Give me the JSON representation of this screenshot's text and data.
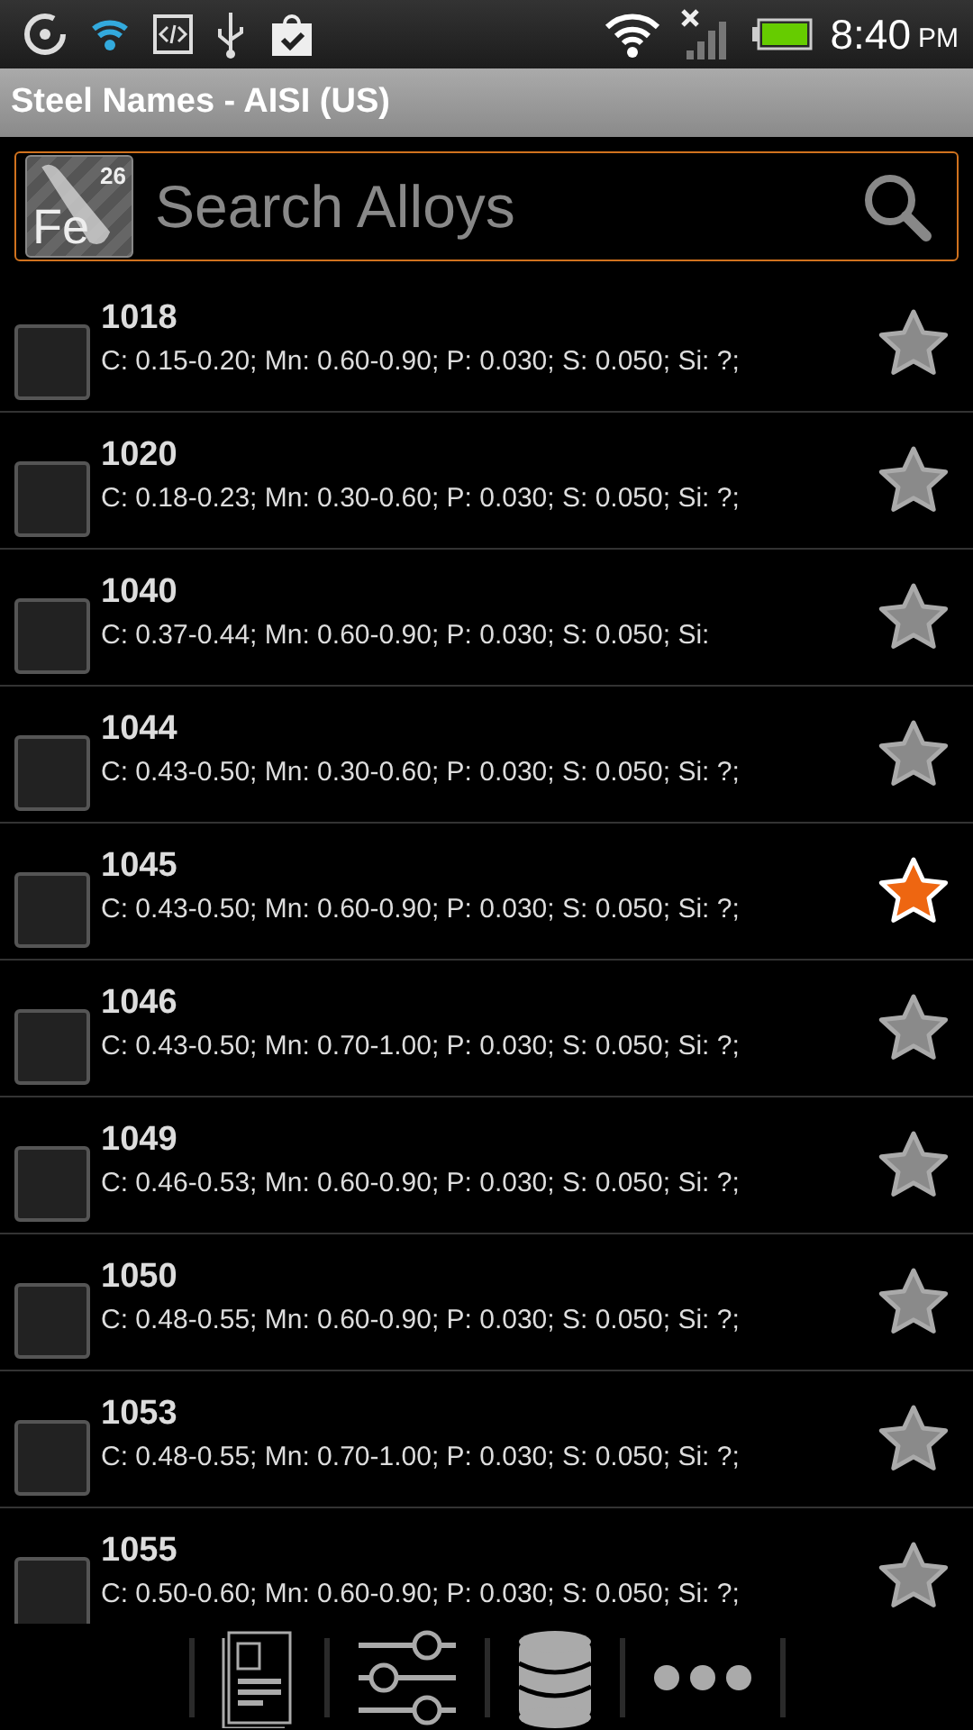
{
  "status_bar": {
    "time": "8:40",
    "ampm": "PM"
  },
  "title": "Steel Names - AISI (US)",
  "search": {
    "logo_symbol": "Fe",
    "logo_number": "26",
    "placeholder": "Search Alloys"
  },
  "alloys": [
    {
      "name": "1018",
      "composition": "C: 0.15-0.20; Mn: 0.60-0.90; P: 0.030; S: 0.050; Si: ?;",
      "checked": false,
      "favorite": false
    },
    {
      "name": "1020",
      "composition": "C: 0.18-0.23; Mn: 0.30-0.60; P: 0.030; S: 0.050; Si: ?;",
      "checked": false,
      "favorite": false
    },
    {
      "name": "1040",
      "composition": "C: 0.37-0.44; Mn: 0.60-0.90; P: 0.030; S: 0.050; Si:",
      "checked": false,
      "favorite": false
    },
    {
      "name": "1044",
      "composition": "C: 0.43-0.50; Mn: 0.30-0.60; P: 0.030; S: 0.050; Si: ?;",
      "checked": false,
      "favorite": false
    },
    {
      "name": "1045",
      "composition": "C: 0.43-0.50; Mn: 0.60-0.90; P: 0.030; S: 0.050; Si: ?;",
      "checked": false,
      "favorite": true
    },
    {
      "name": "1046",
      "composition": "C: 0.43-0.50; Mn: 0.70-1.00; P: 0.030; S: 0.050; Si: ?;",
      "checked": false,
      "favorite": false
    },
    {
      "name": "1049",
      "composition": "C: 0.46-0.53; Mn: 0.60-0.90; P: 0.030; S: 0.050; Si: ?;",
      "checked": false,
      "favorite": false
    },
    {
      "name": "1050",
      "composition": "C: 0.48-0.55; Mn: 0.60-0.90; P: 0.030; S: 0.050; Si: ?;",
      "checked": false,
      "favorite": false
    },
    {
      "name": "1053",
      "composition": "C: 0.48-0.55; Mn: 0.70-1.00; P: 0.030; S: 0.050; Si: ?;",
      "checked": false,
      "favorite": false
    },
    {
      "name": "1055",
      "composition": "C: 0.50-0.60; Mn: 0.60-0.90; P: 0.030; S: 0.050; Si: ?;",
      "checked": false,
      "favorite": false
    }
  ]
}
